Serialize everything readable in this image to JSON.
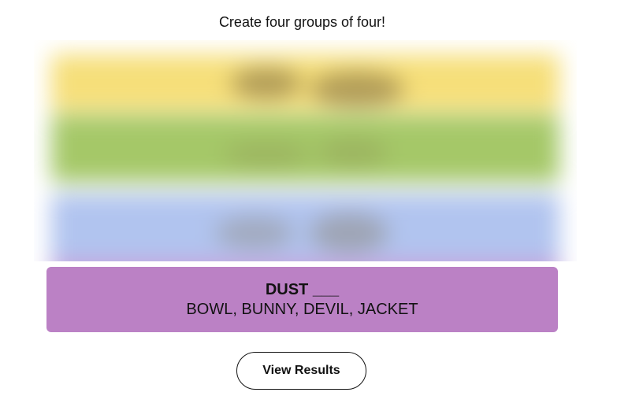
{
  "instructions": "Create four groups of four!",
  "colors": {
    "yellow": "#f6df7a",
    "green": "#a5c868",
    "blue": "#b1c4ef",
    "purple": "#bb81c5"
  },
  "solved_group": {
    "category": "DUST ___",
    "members": "BOWL, BUNNY, DEVIL, JACKET",
    "color": "#bb81c5"
  },
  "view_results_label": "View Results"
}
